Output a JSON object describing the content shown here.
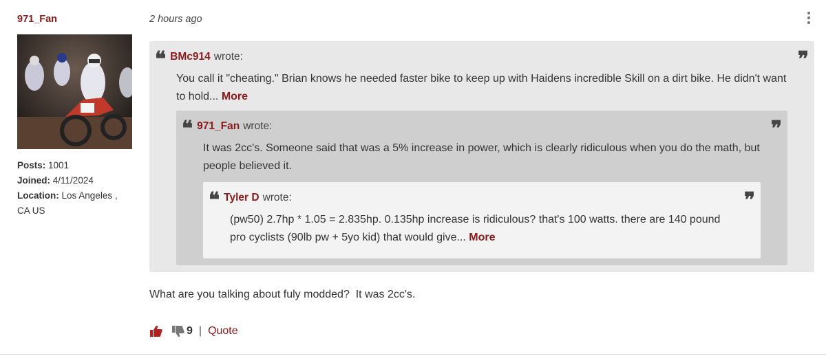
{
  "author": {
    "username": "971_Fan",
    "posts_label": "Posts:",
    "posts_value": "1001",
    "joined_label": "Joined:",
    "joined_value": "4/11/2024",
    "location_label": "Location:",
    "location_value": "Los Angeles , CA US"
  },
  "post": {
    "timestamp": "2 hours ago",
    "menu_icon": "more-vertical-icon",
    "quote1": {
      "author": "BMc914",
      "wrote": "wrote:",
      "text": "You call it \"cheating.\" Brian knows he needed faster bike to keep up with Haidens incredible Skill on a dirt bike. He didn't want to hold...",
      "more": "More"
    },
    "quote2": {
      "author": "971_Fan",
      "wrote": "wrote:",
      "text": "It was 2cc's. Someone said that was a 5% increase in power, which is clearly ridiculous when you do the math, but people believed it."
    },
    "quote3": {
      "author": "Tyler D",
      "wrote": "wrote:",
      "text": "(pw50) 2.7hp * 1.05 = 2.835hp. 0.135hp increase is ridiculous? that's 100 watts. there are 140 pound pro cyclists (90lb pw + 5yo kid) that would give...",
      "more": "More"
    },
    "message": "What are you talking about fuly modded?  It was 2cc's.",
    "dislike_count": "9",
    "separator": "|",
    "quote_label": "Quote",
    "quote_open_glyph": "❝",
    "quote_close_glyph": "❞"
  },
  "colors": {
    "accent": "#8b1a1a",
    "quote_outer": "#e8e8e8",
    "quote_middle": "#cfcfcf",
    "quote_inner": "#f3f3f3"
  }
}
